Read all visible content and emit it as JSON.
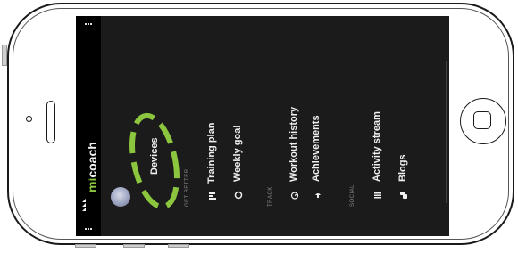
{
  "app": {
    "logo_text": "micoach"
  },
  "menu": {
    "devices": "Devices",
    "sections": [
      {
        "label": "GET BETTER",
        "items": [
          {
            "label": "Training plan",
            "icon": "bar-chart-icon"
          },
          {
            "label": "Weekly goal",
            "icon": "target-icon"
          }
        ]
      },
      {
        "label": "TRACK",
        "items": [
          {
            "label": "Workout history",
            "icon": "stopwatch-icon"
          },
          {
            "label": "Achievements",
            "icon": "trophy-icon"
          }
        ]
      },
      {
        "label": "SOCIAL",
        "items": [
          {
            "label": "Activity stream",
            "icon": "stream-icon"
          },
          {
            "label": "Blogs",
            "icon": "chat-bubbles-icon"
          }
        ]
      }
    ]
  },
  "highlight": {
    "target": "Devices",
    "color": "#8cc63f"
  },
  "colors": {
    "screen_bg": "#1b1b1b",
    "accent_green": "#8cc63f",
    "text": "#f0f0f0"
  }
}
